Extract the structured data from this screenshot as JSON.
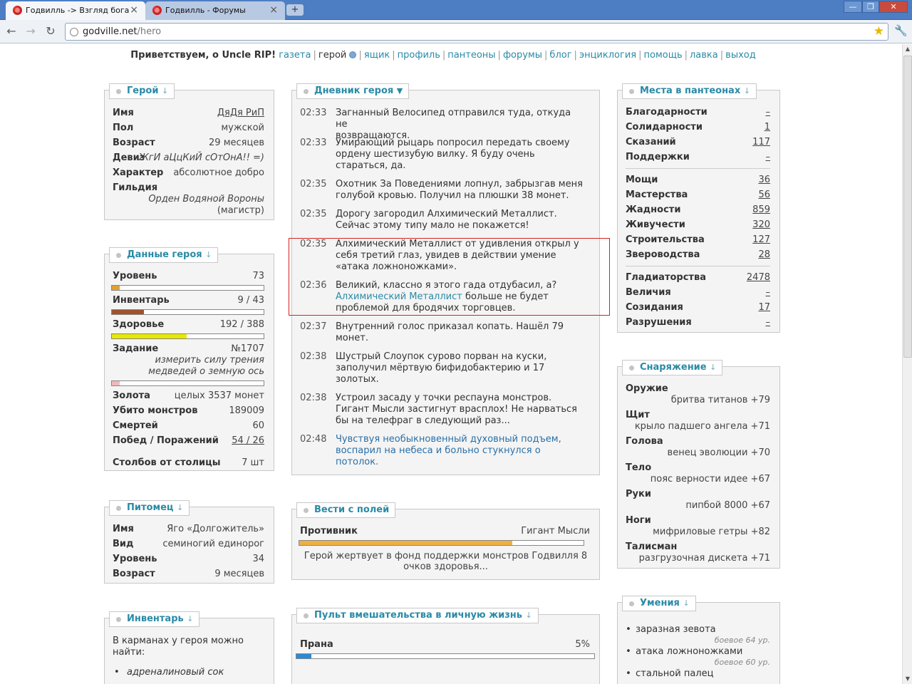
{
  "browser": {
    "tabs": [
      {
        "title": "Годвилль -> Взгляд бога",
        "close": "×"
      },
      {
        "title": "Годвилль - Форумы",
        "close": "×"
      }
    ],
    "new_tab": "+",
    "window": {
      "min": "—",
      "max": "❐",
      "close": "✕"
    },
    "url_host": "godville.net",
    "url_path": "/hero"
  },
  "topnav": {
    "greeting": "Приветствуем, о Uncle RIP!",
    "items": [
      "газета",
      "герой",
      "ящик",
      "профиль",
      "пантеоны",
      "форумы",
      "блог",
      "энциклогия",
      "помощь",
      "лавка",
      "выход"
    ]
  },
  "hero": {
    "title": "Герой",
    "arrow": "↓",
    "name_label": "Имя",
    "name": "ДяДя РиП",
    "gender_label": "Пол",
    "gender": "мужской",
    "age_label": "Возраст",
    "age": "29 месяцев",
    "motto_label": "Девиз",
    "motto": "ЖгИ аЦцКиЙ сОтОнА!! =)",
    "character_label": "Характер",
    "character": "абсолютное добро",
    "guild_label": "Гильдия",
    "guild": "Орден Водяной Вороны",
    "guild_rank": "(магистр)"
  },
  "stats": {
    "title": "Данные героя",
    "arrow": "↓",
    "level_label": "Уровень",
    "level": "73",
    "level_progress": 0.05,
    "inventory_label": "Инвентарь",
    "inventory": "9 / 43",
    "inventory_progress": 0.209,
    "health_label": "Здоровье",
    "health": "192 / 388",
    "health_progress": 0.495,
    "quest_label": "Задание",
    "quest_number": "№1707",
    "quest_line1": "измерить силу трения",
    "quest_line2": "медведей о земную ось",
    "quest_progress": 0.05,
    "gold_label": "Золота",
    "gold": "целых 3537 монет",
    "kills_label": "Убито монстров",
    "kills": "189009",
    "deaths_label": "Смертей",
    "deaths": "60",
    "wins_label": "Побед / Поражений",
    "wins": "54 / 26",
    "poles_label": "Столбов от столицы",
    "poles": "7 шт"
  },
  "pet": {
    "title": "Питомец",
    "arrow": "↓",
    "name_label": "Имя",
    "name": "Яго «Долгожитель»",
    "kind_label": "Вид",
    "kind": "семиногий единорог",
    "level_label": "Уровень",
    "level": "34",
    "age_label": "Возраст",
    "age": "9 месяцев"
  },
  "inventory": {
    "title": "Инвентарь",
    "arrow": "↓",
    "intro_line1": "В карманах у героя можно",
    "intro_line2": "найти:",
    "items": [
      "адреналиновый сок"
    ]
  },
  "diary": {
    "title": "Дневник героя",
    "arrow": "▼",
    "entries": [
      {
        "time": "02:33",
        "lines": [
          "Загнанный Велосипед отправился туда, откуда не",
          "возвращаются."
        ]
      },
      {
        "time": "02:33",
        "lines": [
          "Умирающий рыцарь попросил передать своему",
          "ордену шестизубую вилку. Я буду очень",
          "стараться, да."
        ]
      },
      {
        "time": "02:35",
        "lines": [
          "Охотник За Поведениями лопнул, забрызгав меня",
          "голубой кровью. Получил на плюшки 38 монет."
        ]
      },
      {
        "time": "02:35",
        "lines": [
          "Дорогу загородил Алхимический Металлист.",
          "Сейчас этому типу мало не покажется!"
        ]
      },
      {
        "time": "02:35",
        "lines": [
          "Алхимический Металлист от удивления открыл у",
          "себя третий глаз, увидев в действии умение",
          "«атака ложноножками»."
        ]
      },
      {
        "time": "02:36",
        "line1": "Великий, классно я этого гада отдубасил, а?",
        "line2_link": "Алхимический Металлист",
        "line2_rest": " больше не будет",
        "line3": "проблемой для бродячих торговцев."
      },
      {
        "time": "02:37",
        "lines": [
          "Внутренний голос приказал копать. Нашёл 79",
          "монет."
        ]
      },
      {
        "time": "02:38",
        "lines": [
          "Шустрый Слоупок сурово порван на куски,",
          "заполучил мёртвую бифидобактерию и 17",
          "золотых."
        ]
      },
      {
        "time": "02:38",
        "lines": [
          "Устроил засаду у точки респауна монстров.",
          "Гигант Мысли застигнут врасплох! Не нарваться",
          "бы на телефраг в следующий раз..."
        ]
      },
      {
        "time": "02:48",
        "lines": [
          "Чувствуя необыкновенный духовный подъем,",
          "воспарил на небеса и больно стукнулся о",
          "потолок."
        ]
      }
    ]
  },
  "field_news": {
    "title": "Вести с полей",
    "opponent_label": "Противник",
    "opponent": "Гигант Мысли",
    "opponent_health": 0.75,
    "text_line1": "Герой жертвует в фонд поддержки монстров Годвилля 8",
    "text_line2": "очков здоровья..."
  },
  "remote": {
    "title": "Пульт вмешательства в личную жизнь",
    "arrow": "↓",
    "prana_label": "Прана",
    "prana": "5%",
    "prana_progress": 0.05
  },
  "pantheons": {
    "title": "Места в пантеонах",
    "arrow": "↓",
    "group1": [
      {
        "label": "Благодарности",
        "value": "–"
      },
      {
        "label": "Солидарности",
        "value": "1"
      },
      {
        "label": "Сказаний",
        "value": "117"
      },
      {
        "label": "Поддержки",
        "value": "–"
      }
    ],
    "group2": [
      {
        "label": "Мощи",
        "value": "36"
      },
      {
        "label": "Мастерства",
        "value": "56"
      },
      {
        "label": "Жадности",
        "value": "859"
      },
      {
        "label": "Живучести",
        "value": "320"
      },
      {
        "label": "Строительства",
        "value": "127"
      },
      {
        "label": "Звероводства",
        "value": "28"
      }
    ],
    "group3": [
      {
        "label": "Гладиаторства",
        "value": "2478"
      },
      {
        "label": "Величия",
        "value": "–"
      },
      {
        "label": "Созидания",
        "value": "17"
      },
      {
        "label": "Разрушения",
        "value": "–"
      }
    ]
  },
  "equipment": {
    "title": "Снаряжение",
    "arrow": "↓",
    "items": [
      {
        "slot": "Оружие",
        "item": "бритва титанов +79"
      },
      {
        "slot": "Щит",
        "item": "крыло падшего ангела +71"
      },
      {
        "slot": "Голова",
        "item": "венец эволюции +70"
      },
      {
        "slot": "Тело",
        "item": "пояс верности идее +67"
      },
      {
        "slot": "Руки",
        "item": "пипбой 8000 +67"
      },
      {
        "slot": "Ноги",
        "item": "мифриловые гетры +82"
      },
      {
        "slot": "Талисман",
        "item": "разгрузочная дискета +71"
      }
    ]
  },
  "skills": {
    "title": "Умения",
    "arrow": "↓",
    "items": [
      {
        "name": "заразная зевота",
        "level": "боевое 64 ур."
      },
      {
        "name": "атака ложноножками",
        "level": "боевое 60 ур."
      },
      {
        "name": "стальной палец",
        "level": ""
      }
    ]
  },
  "colors": {
    "accent": "#2a8aa6",
    "level_bar": "#e0a030",
    "inventory_bar": "#a0522d",
    "health_bar": "#e8e800",
    "quest_bar": "#f2b8b8",
    "opponent_bar": "#f0b040",
    "prana_bar": "#2a8ad6",
    "highlight": "#d32222"
  }
}
